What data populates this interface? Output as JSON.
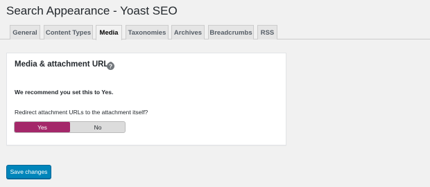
{
  "page": {
    "title": "Search Appearance - Yoast SEO"
  },
  "tabs": [
    {
      "label": "General",
      "active": false
    },
    {
      "label": "Content Types",
      "active": false
    },
    {
      "label": "Media",
      "active": true
    },
    {
      "label": "Taxonomies",
      "active": false
    },
    {
      "label": "Archives",
      "active": false
    },
    {
      "label": "Breadcrumbs",
      "active": false
    },
    {
      "label": "RSS",
      "active": false
    }
  ],
  "media_section": {
    "title": "Media & attachment URLs",
    "help_icon": "question-circle-icon",
    "recommendation": "We recommend you set this to Yes.",
    "question": "Redirect attachment URLs to the attachment itself?",
    "toggle": {
      "yes_label": "Yes",
      "no_label": "No",
      "selected": "Yes"
    }
  },
  "footer": {
    "save_label": "Save changes"
  },
  "colors": {
    "accent_toggle": "#a4286a",
    "button_primary": "#0085ba",
    "background": "#f1f1f1"
  }
}
